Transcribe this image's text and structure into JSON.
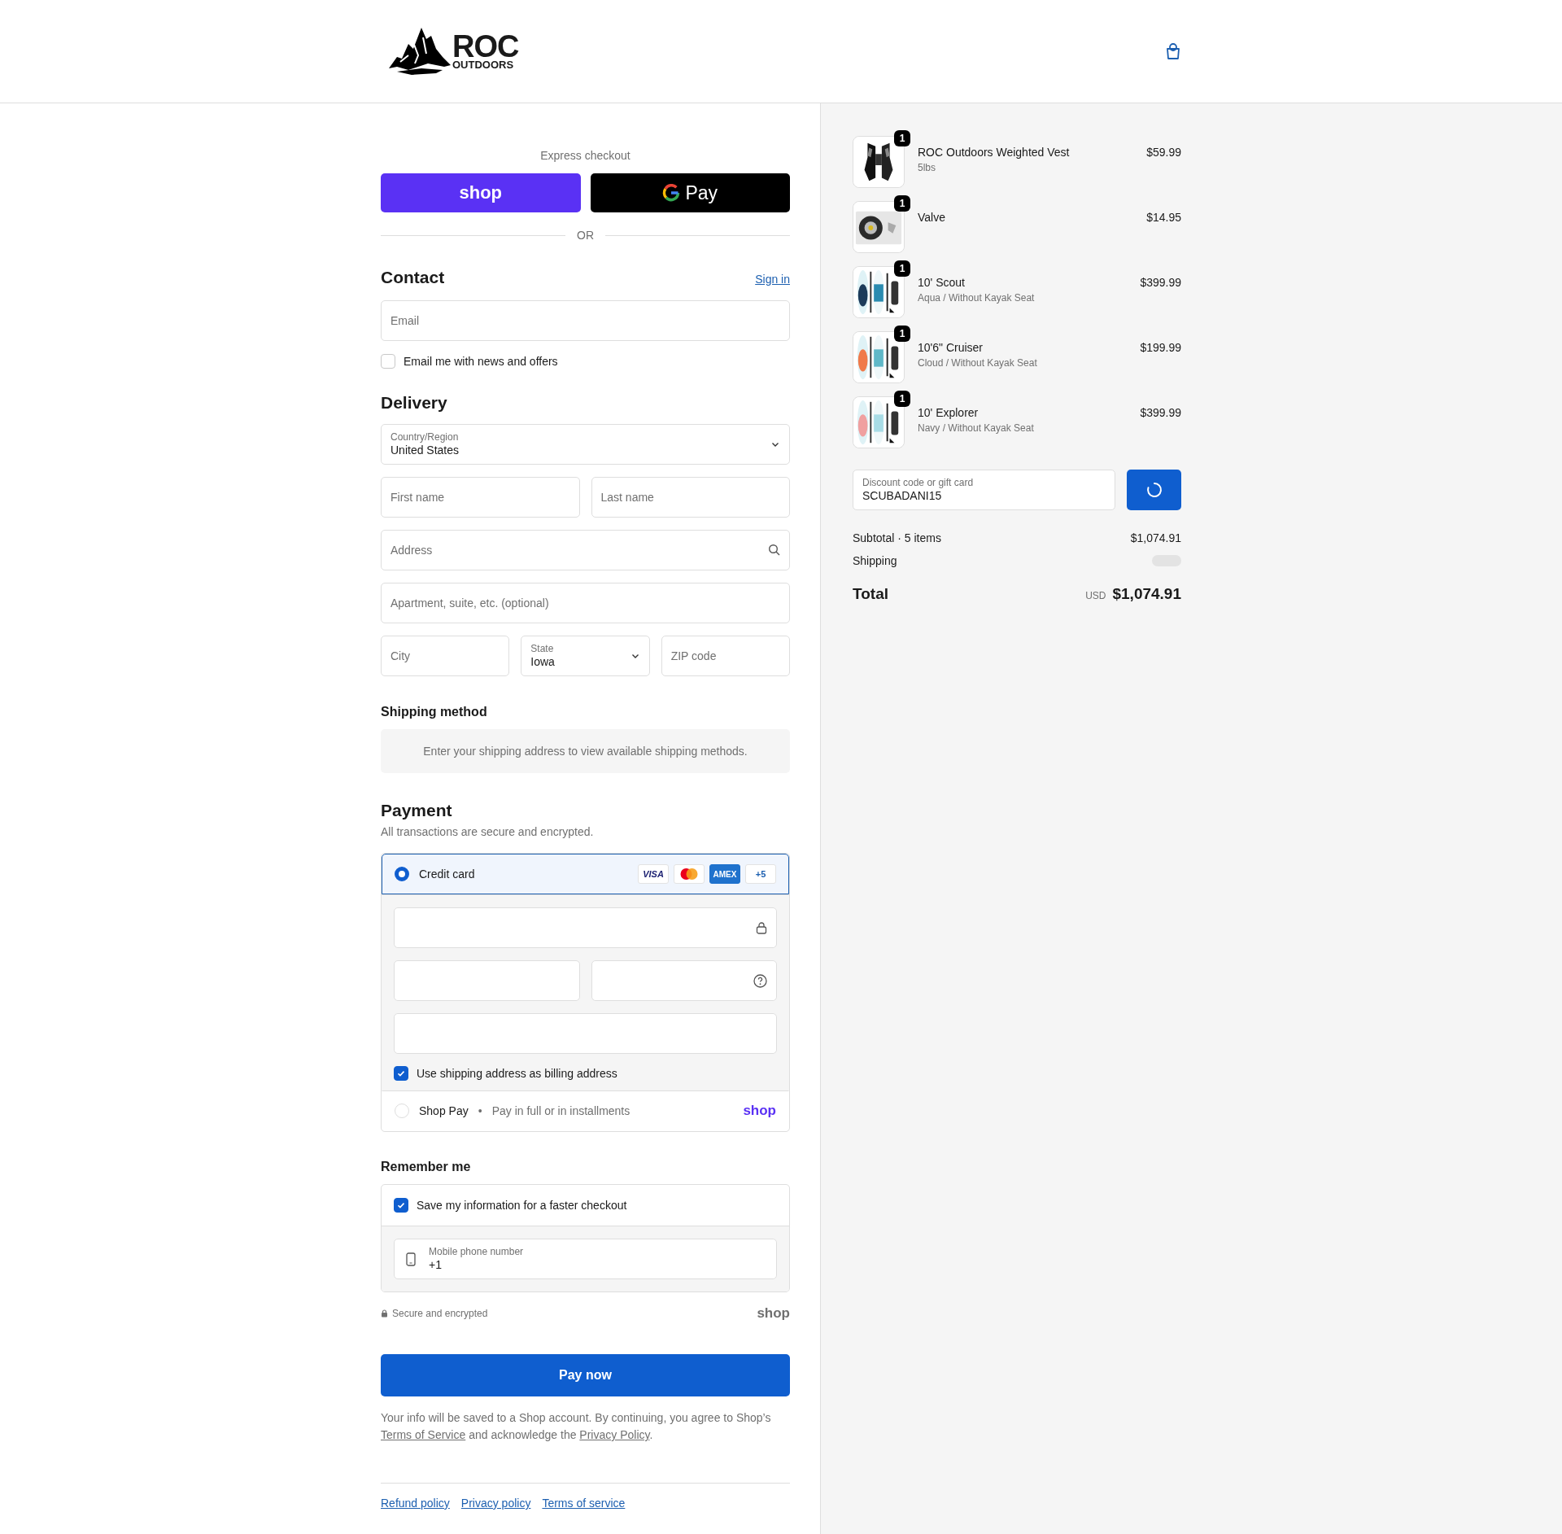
{
  "header": {
    "logo": {
      "name": "ROC",
      "tagline": "OUTDOORS"
    }
  },
  "express_checkout": {
    "title": "Express checkout",
    "buttons": [
      {
        "kind": "shop",
        "label": "shop"
      },
      {
        "kind": "gpay",
        "label": "Pay"
      }
    ],
    "divider": "OR"
  },
  "contact": {
    "title": "Contact",
    "sign_in": "Sign in",
    "email": {
      "placeholder": "Email"
    },
    "newsletter": {
      "label": "Email me with news and offers",
      "checked": false
    }
  },
  "delivery": {
    "title": "Delivery",
    "rows": [
      [
        {
          "kind": "select",
          "label": "Country/Region",
          "value": "United States"
        }
      ],
      [
        {
          "kind": "text",
          "placeholder": "First name"
        },
        {
          "kind": "text",
          "placeholder": "Last name"
        }
      ],
      [
        {
          "kind": "search",
          "placeholder": "Address"
        }
      ],
      [
        {
          "kind": "text",
          "placeholder": "Apartment, suite, etc. (optional)"
        }
      ],
      [
        {
          "kind": "text",
          "placeholder": "City"
        },
        {
          "kind": "select",
          "label": "State",
          "value": "Iowa"
        },
        {
          "kind": "text",
          "placeholder": "ZIP code"
        }
      ]
    ]
  },
  "shipping_method": {
    "title": "Shipping method",
    "notice": "Enter your shipping address to view available shipping methods."
  },
  "payment": {
    "title": "Payment",
    "subtitle": "All transactions are secure and encrypted.",
    "methods": [
      {
        "kind": "card",
        "label": "Credit card",
        "selected": true,
        "brands": [
          {
            "kind": "visa",
            "label": "VISA"
          },
          {
            "kind": "mastercard"
          },
          {
            "kind": "amex",
            "label": "AMEX"
          },
          {
            "kind": "more",
            "label": "+5"
          }
        ],
        "card_fields": [
          [
            {
              "kind": "lock"
            }
          ],
          [
            {
              "kind": "plain"
            },
            {
              "kind": "help"
            }
          ],
          [
            {
              "kind": "plain"
            }
          ]
        ],
        "billing": {
          "label": "Use shipping address as billing address",
          "checked": true
        }
      },
      {
        "kind": "shop_pay",
        "label": "Shop Pay",
        "separator": "•",
        "note": "Pay in full or in installments",
        "logo": "shop",
        "selected": false
      }
    ]
  },
  "remember_me": {
    "title": "Remember me",
    "save": {
      "label": "Save my information for a faster checkout",
      "checked": true
    },
    "phone": {
      "label": "Mobile phone number",
      "value": "+1"
    }
  },
  "secure": {
    "label": "Secure and encrypted",
    "logo": "shop"
  },
  "pay_button": "Pay now",
  "consent": [
    {
      "text": "Your info will be saved to a Shop account. By continuing, you agree to Shop’s "
    },
    {
      "link": "Terms of Service"
    },
    {
      "text": " and acknowledge the "
    },
    {
      "link": "Privacy Policy"
    },
    {
      "text": "."
    }
  ],
  "footer_links": [
    "Refund policy",
    "Privacy policy",
    "Terms of service"
  ],
  "order": {
    "items": [
      {
        "name": "ROC Outdoors Weighted Vest",
        "variant": "5lbs",
        "price": "$59.99",
        "quantity": "1",
        "kind": "vest"
      },
      {
        "name": "Valve",
        "price": "$14.95",
        "quantity": "1",
        "kind": "valve"
      },
      {
        "name": "10' Scout",
        "variant": "Aqua / Without Kayak Seat",
        "price": "$399.99",
        "quantity": "1",
        "kind": "board"
      },
      {
        "name": "10'6\" Cruiser",
        "variant": "Cloud / Without Kayak Seat",
        "price": "$199.99",
        "quantity": "1",
        "kind": "board"
      },
      {
        "name": "10' Explorer",
        "variant": "Navy / Without Kayak Seat",
        "price": "$399.99",
        "quantity": "1",
        "kind": "board"
      }
    ],
    "discount": {
      "label": "Discount code or gift card",
      "value": "SCUBADANI15"
    },
    "subtotal": {
      "label": "Subtotal · 5 items",
      "value": "$1,074.91"
    },
    "shipping": {
      "label": "Shipping"
    },
    "total": {
      "label": "Total",
      "currency": "USD",
      "value": "$1,074.91"
    }
  }
}
